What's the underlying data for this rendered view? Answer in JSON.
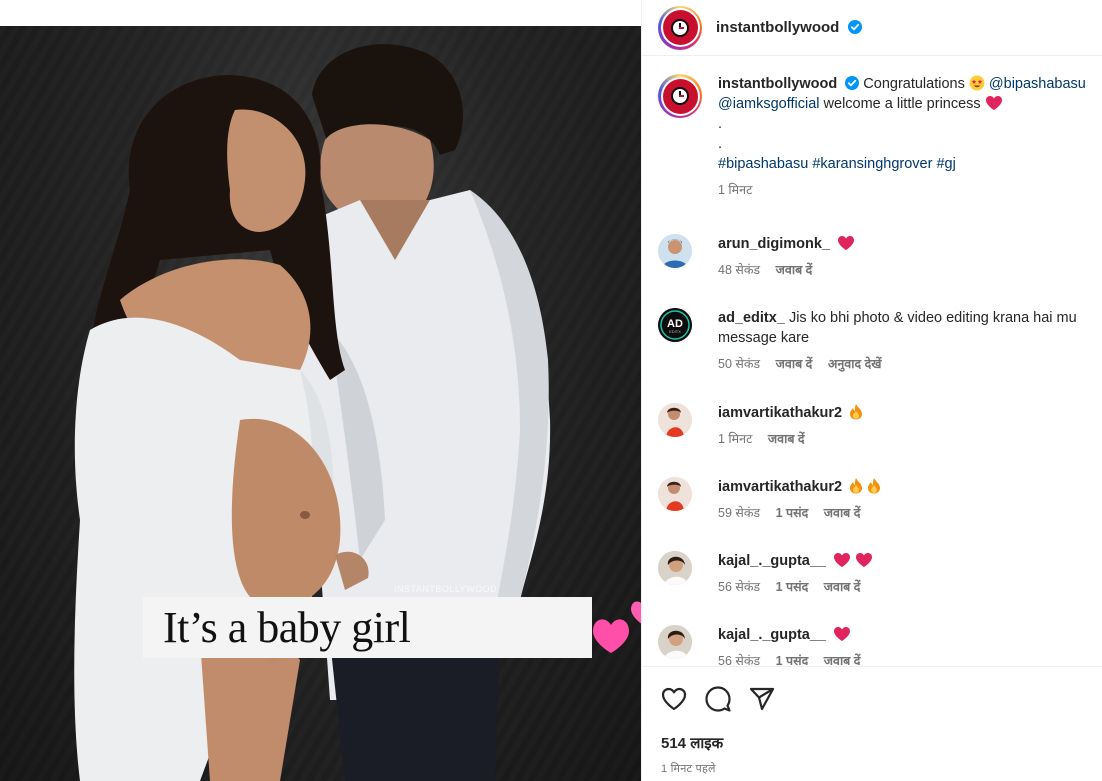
{
  "post": {
    "username": "instantbollywood",
    "watermark": "INSTANTBOLLYWOOD",
    "banner_text": "It’s a baby girl"
  },
  "caption": {
    "username": "instantbollywood",
    "text_1": "Congratulations",
    "mention_1": "@bipashabasu",
    "mention_2": "@iamksgofficial",
    "text_2": "welcome a little princess",
    "dot_1": ".",
    "dot_2": ".",
    "hashtags": "#bipashabasu #karansinghgrover #gj",
    "time": "1 मिनट"
  },
  "comments": [
    {
      "username": "arun_digimonk_",
      "text": "",
      "time": "48 सेकंड",
      "likes": "",
      "reply": "जवाब दें",
      "translate": ""
    },
    {
      "username": "ad_editx_",
      "text": "Jis ko bhi photo & video editing krana hai mu",
      "text_2": "message kare",
      "time": "50 सेकंड",
      "likes": "",
      "reply": "जवाब दें",
      "translate": "अनुवाद देखें"
    },
    {
      "username": "iamvartikathakur2",
      "text": "",
      "time": "1 मिनट",
      "likes": "",
      "reply": "जवाब दें",
      "translate": ""
    },
    {
      "username": "iamvartikathakur2",
      "text": "",
      "time": "59 सेकंड",
      "likes": "1 पसंद",
      "reply": "जवाब दें",
      "translate": ""
    },
    {
      "username": "kajal_._gupta__",
      "text": "",
      "time": "56 सेकंड",
      "likes": "1 पसंद",
      "reply": "जवाब दें",
      "translate": ""
    },
    {
      "username": "kajal_._gupta__",
      "text": "",
      "time": "56 सेकंड",
      "likes": "1 पसंद",
      "reply": "जवाब दें",
      "translate": ""
    }
  ],
  "footer": {
    "likes": "514 लाइक",
    "posted": "1 मिनट पहले"
  },
  "icons": {
    "like": "heart-outline-icon",
    "comment": "comment-bubble-icon",
    "share": "paper-plane-icon",
    "verified": "verified-badge-icon"
  },
  "colors": {
    "verified": "#0095f6",
    "link": "#00376b",
    "heart": "#ed4956",
    "muted": "#737373"
  }
}
